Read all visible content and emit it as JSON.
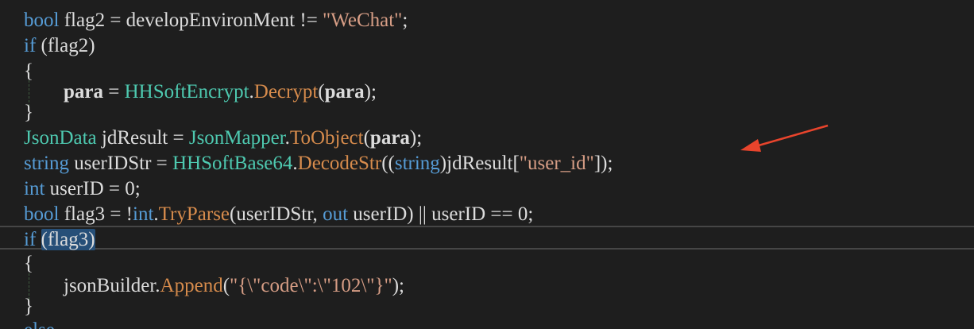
{
  "lines": [
    {
      "tokens": [
        {
          "t": "bool",
          "c": "kw"
        },
        {
          "t": " flag2 = developEnvironMent != ",
          "c": "pl"
        },
        {
          "t": "\"WeChat\"",
          "c": "st"
        },
        {
          "t": ";",
          "c": "pl"
        }
      ]
    },
    {
      "tokens": [
        {
          "t": "if",
          "c": "kw"
        },
        {
          "t": " (flag2)",
          "c": "pl"
        }
      ]
    },
    {
      "tokens": [
        {
          "t": "{",
          "c": "pl"
        }
      ]
    },
    {
      "tokens": [
        {
          "t": "para",
          "c": "pl bold"
        },
        {
          "t": " = ",
          "c": "pl"
        },
        {
          "t": "HHSoftEncrypt",
          "c": "ty"
        },
        {
          "t": ".",
          "c": "pl"
        },
        {
          "t": "Decrypt",
          "c": "fn"
        },
        {
          "t": "(",
          "c": "pl"
        },
        {
          "t": "para",
          "c": "pl bold"
        },
        {
          "t": ");",
          "c": "pl"
        }
      ]
    },
    {
      "tokens": [
        {
          "t": "}",
          "c": "pl"
        }
      ]
    },
    {
      "tokens": [
        {
          "t": "JsonData",
          "c": "ty"
        },
        {
          "t": " jdResult = ",
          "c": "pl"
        },
        {
          "t": "JsonMapper",
          "c": "ty"
        },
        {
          "t": ".",
          "c": "pl"
        },
        {
          "t": "ToObject",
          "c": "fn"
        },
        {
          "t": "(",
          "c": "pl"
        },
        {
          "t": "para",
          "c": "pl bold"
        },
        {
          "t": ");",
          "c": "pl"
        }
      ]
    },
    {
      "tokens": [
        {
          "t": "string",
          "c": "kw"
        },
        {
          "t": " userIDStr = ",
          "c": "pl"
        },
        {
          "t": "HHSoftBase64",
          "c": "ty"
        },
        {
          "t": ".",
          "c": "pl"
        },
        {
          "t": "DecodeStr",
          "c": "fn"
        },
        {
          "t": "((",
          "c": "pl"
        },
        {
          "t": "string",
          "c": "kw"
        },
        {
          "t": ")jdResult[",
          "c": "pl"
        },
        {
          "t": "\"user_id\"",
          "c": "st"
        },
        {
          "t": "]);",
          "c": "pl"
        }
      ]
    },
    {
      "tokens": [
        {
          "t": "int",
          "c": "kw"
        },
        {
          "t": " userID = 0;",
          "c": "pl"
        }
      ]
    },
    {
      "tokens": [
        {
          "t": "bool",
          "c": "kw"
        },
        {
          "t": " flag3 = !",
          "c": "pl"
        },
        {
          "t": "int",
          "c": "kw"
        },
        {
          "t": ".",
          "c": "pl"
        },
        {
          "t": "TryParse",
          "c": "fn"
        },
        {
          "t": "(userIDStr, ",
          "c": "pl"
        },
        {
          "t": "out",
          "c": "kw"
        },
        {
          "t": " userID) || userID == 0;",
          "c": "pl"
        }
      ]
    },
    {
      "tokens": [
        {
          "t": "if",
          "c": "kw"
        },
        {
          "t": " ",
          "c": "pl"
        },
        {
          "t": "(flag3)",
          "c": "pl sel"
        }
      ]
    },
    {
      "tokens": [
        {
          "t": "{",
          "c": "pl"
        }
      ]
    },
    {
      "tokens": [
        {
          "t": "jsonBuilder",
          "c": "pl"
        },
        {
          "t": ".",
          "c": "pl"
        },
        {
          "t": "Append",
          "c": "fn"
        },
        {
          "t": "(",
          "c": "pl"
        },
        {
          "t": "\"{\\\"code\\\":\\\"102\\\"}\"",
          "c": "st"
        },
        {
          "t": ");",
          "c": "pl"
        }
      ]
    },
    {
      "tokens": [
        {
          "t": "}",
          "c": "pl"
        }
      ]
    },
    {
      "tokens": [
        {
          "t": "else",
          "c": "kw"
        }
      ]
    }
  ],
  "colors": {
    "background": "#1e1e1e",
    "keyword": "#569cd6",
    "type": "#4ec9b0",
    "method": "#d68b4c",
    "string": "#d69d85",
    "plain": "#dcdcdc",
    "annotation_arrow": "#e8442c"
  },
  "annotation": {
    "icon": "arrow-icon",
    "target": "\"user_id\""
  }
}
